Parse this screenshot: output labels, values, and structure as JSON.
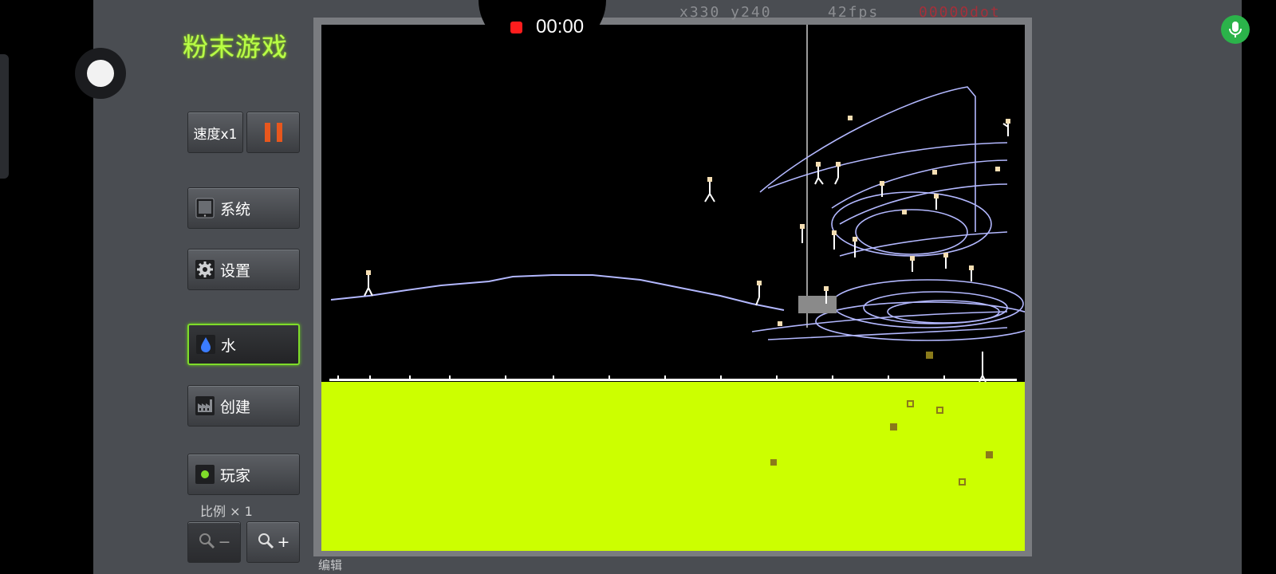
{
  "app": {
    "title": "粉末游戏"
  },
  "recording": {
    "time": "00:00"
  },
  "status": {
    "coords": "x330 y240",
    "fps": "42fps",
    "dots": "00000dot"
  },
  "menu": {
    "speed_label": "速度x1",
    "system_label": "系统",
    "settings_label": "设置",
    "water_label": "水",
    "create_label": "创建",
    "player_label": "玩家",
    "scale_label": "比例 × 1",
    "zoom_out_label": "−",
    "zoom_in_label": "+"
  },
  "footer": {
    "mode_label": "编辑"
  },
  "colors": {
    "accent": "#b8ff44",
    "selected_border": "#7fdc2a",
    "powder": "#ccff00",
    "wire": "#b3b8ff",
    "pause": "#e8571d",
    "record": "#ff1d1d"
  },
  "icons": [
    "tablet-icon",
    "gear-icon",
    "water-drop-icon",
    "factory-icon",
    "player-dot-icon",
    "search-icon",
    "microphone-icon",
    "record-icon"
  ]
}
